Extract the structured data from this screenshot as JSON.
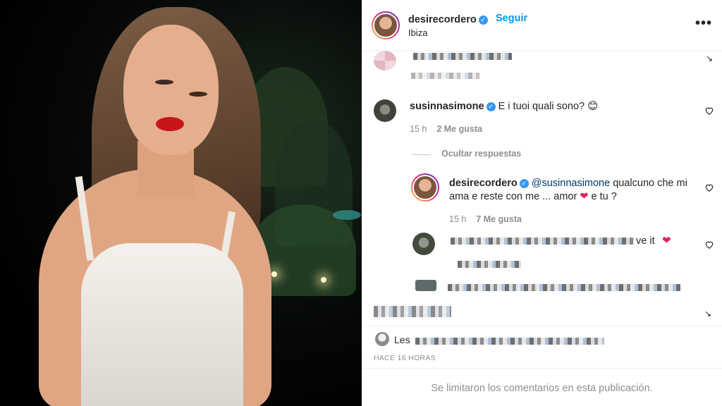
{
  "post": {
    "username": "desirecordero",
    "follow_label": "Seguir",
    "location": "Ibiza"
  },
  "comments": {
    "c2": {
      "username": "susinnasimone",
      "text": "E i tuoi quali sono? 😊",
      "time": "15 h",
      "likes": "2 Me gusta"
    },
    "hide_replies_label": "Ocultar respuestas",
    "reply": {
      "username": "desirecordero",
      "mention": "@susinnasimone",
      "text_part1": " qualcuno che mi ama e reste con me ... amor ",
      "heart": "❤",
      "text_part2": " e tu ?",
      "time": "15 h",
      "likes": "7 Me gusta"
    },
    "c4_tail": "ve it",
    "c4_heart": "❤"
  },
  "likes_prefix": "Les",
  "time_ago": "HACE 16 HORAS",
  "footer_notice": "Se limitaron los comentarios en esta publicación.",
  "colors": {
    "link_blue": "#0095f6",
    "verified_blue": "#3897f0",
    "meta_gray": "#8e8e8e",
    "heart_red": "#e0245e"
  }
}
